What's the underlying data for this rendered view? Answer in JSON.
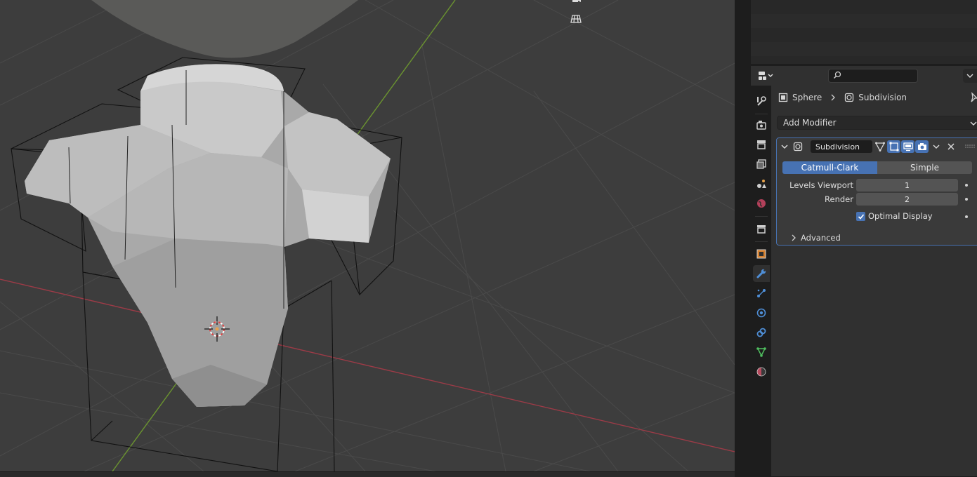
{
  "properties": {
    "search": {
      "value": "",
      "placeholder": ""
    },
    "breadcrumb": {
      "object": "Sphere",
      "modifier": "Subdivision"
    },
    "add_modifier_label": "Add Modifier",
    "modifier": {
      "name": "Subdivision",
      "type_options": [
        "Catmull-Clark",
        "Simple"
      ],
      "selected_type": "Catmull-Clark",
      "levels_viewport_label": "Levels Viewport",
      "levels_viewport_value": "1",
      "render_label": "Render",
      "render_value": "2",
      "optimal_display_label": "Optimal Display",
      "optimal_display_checked": true,
      "advanced_label": "Advanced"
    },
    "tabs": [
      "tool",
      "render",
      "output",
      "view-layer",
      "scene",
      "world",
      "collection",
      "object",
      "modifiers",
      "particles",
      "physics",
      "constraints",
      "data",
      "material"
    ],
    "active_tab": "modifiers"
  },
  "colors": {
    "viewport_bg": "#3d3d3d",
    "panel_bg": "#303030",
    "accent": "#4772b3",
    "x_axis": "#b34050",
    "y_axis": "#6d9a2c"
  }
}
